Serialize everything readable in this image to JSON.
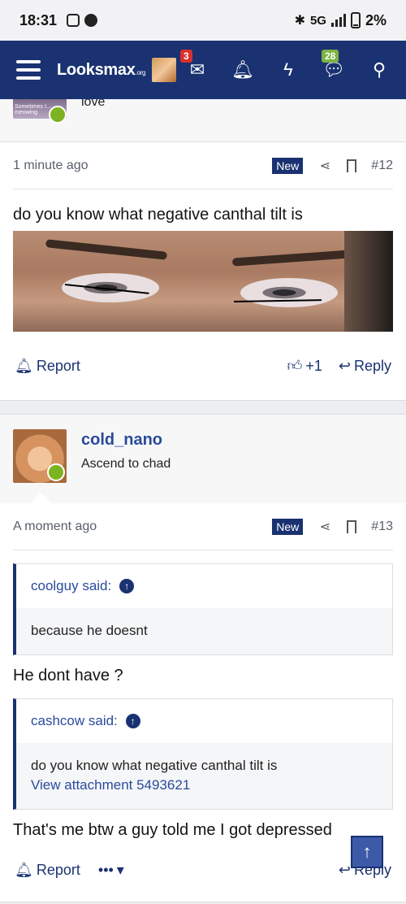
{
  "status_bar": {
    "time": "18:31",
    "battery": "2%",
    "network": "5G"
  },
  "nav": {
    "logo": "Looksmax",
    "logo_suffix": ".org",
    "inbox_badge": "3",
    "messages_badge": "28"
  },
  "previous_post": {
    "text": "love",
    "avatar_caption": "Sometimes I... meowing"
  },
  "post1": {
    "time": "1 minute ago",
    "tag": "New",
    "number": "#12",
    "text": "do you know what negative canthal tilt is",
    "report": "Report",
    "likes": "+1",
    "reply": "Reply"
  },
  "post2": {
    "username": "cold_nano",
    "user_title": "Ascend to chad",
    "time": "A moment ago",
    "tag": "New",
    "number": "#13",
    "quote1_author": "coolguy said:",
    "quote1_text": "because he doesnt",
    "text1": "He dont have ?",
    "quote2_author": "cashcow said:",
    "quote2_text": "do you know what negative canthal tilt is",
    "quote2_link": "View attachment 5493621",
    "text2": "That's me btw a guy told me I got depressed",
    "report": "Report",
    "more": "•••",
    "reply": "Reply"
  }
}
